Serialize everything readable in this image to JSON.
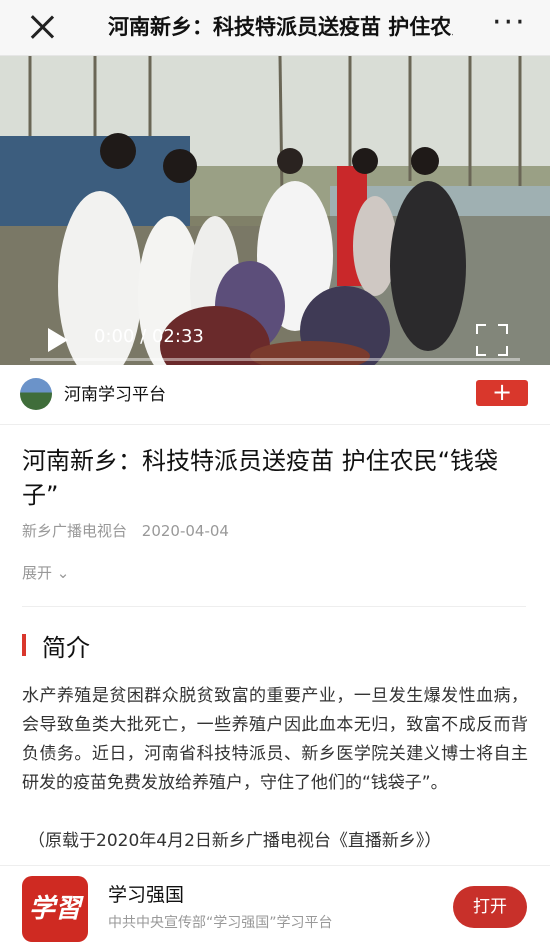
{
  "topbar": {
    "title": "河南新乡：科技特派员送疫苗 护住农民“钱袋子”",
    "close_icon": "close-icon",
    "more_label": "···"
  },
  "video": {
    "current_time": "0:00",
    "separator": "/",
    "duration": "02:33",
    "progress": 0,
    "play_icon": "play-icon",
    "fullscreen_icon": "fullscreen-icon"
  },
  "channel": {
    "name": "河南学习平台",
    "follow_label": "+"
  },
  "article": {
    "title": "河南新乡：科技特派员送疫苗 护住农民“钱袋子”",
    "source": "新乡广播电视台",
    "date": "2020-04-04",
    "expand_label": "展开"
  },
  "section": {
    "title": "简介",
    "summary": "水产养殖是贫困群众脱贫致富的重要产业，一旦发生爆发性血病，会导致鱼类大批死亡，一些养殖户因此血本无归，致富不成反而背负债务。近日，河南省科技特派员、新乡医学院关建义博士将自主研发的疫苗免费发放给养殖户，守住了他们的“钱袋子”。",
    "note": "（原载于2020年4月2日新乡广播电视台《直播新乡》）"
  },
  "footer": {
    "logo_text": "学習",
    "app_name": "学习强国",
    "app_subtitle": "中共中央宣传部“学习强国”学习平台",
    "open_label": "打开"
  },
  "colors": {
    "accent_red": "#d9372c",
    "open_button": "#c8302a"
  }
}
